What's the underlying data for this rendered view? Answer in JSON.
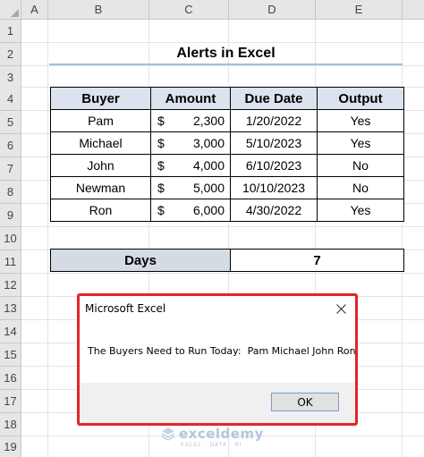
{
  "spreadsheet": {
    "columns": [
      "A",
      "B",
      "C",
      "D",
      "E"
    ],
    "rows": [
      "1",
      "2",
      "3",
      "4",
      "5",
      "6",
      "7",
      "8",
      "9",
      "10",
      "11",
      "12",
      "13",
      "14",
      "15",
      "16",
      "17",
      "18",
      "19"
    ]
  },
  "title": "Alerts in Excel",
  "table": {
    "headers": [
      "Buyer",
      "Amount",
      "Due Date",
      "Output"
    ],
    "currency_symbol": "$",
    "rows": [
      {
        "buyer": "Pam",
        "amount": "2,300",
        "due": "1/20/2022",
        "output": "Yes"
      },
      {
        "buyer": "Michael",
        "amount": "3,000",
        "due": "5/10/2023",
        "output": "Yes"
      },
      {
        "buyer": "John",
        "amount": "4,000",
        "due": "6/10/2023",
        "output": "No"
      },
      {
        "buyer": "Newman",
        "amount": "5,000",
        "due": "10/10/2023",
        "output": "No"
      },
      {
        "buyer": "Ron",
        "amount": "6,000",
        "due": "4/30/2022",
        "output": "Yes"
      }
    ]
  },
  "days": {
    "label": "Days",
    "value": "7"
  },
  "dialog": {
    "title": "Microsoft Excel",
    "close_icon": "close-icon",
    "message": "The Buyers Need to Run Today:  Pam Michael John Ron",
    "ok_label": "OK",
    "highlight_color": "#e0252b"
  },
  "watermark": {
    "name": "exceldemy",
    "tagline": "EXCEL · DATA · BI"
  },
  "colors": {
    "header_fill": "#dbe3ef",
    "days_fill": "#d5dbe4",
    "title_underline": "#9cc3e5"
  }
}
